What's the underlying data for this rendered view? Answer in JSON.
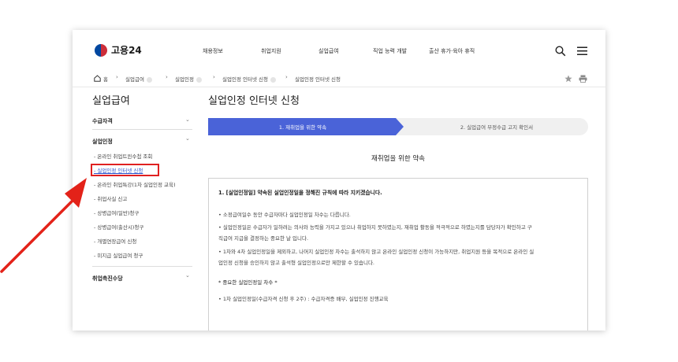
{
  "header": {
    "logo_text": "고용24",
    "nav": [
      "채용정보",
      "취업지원",
      "실업급여",
      "직업 능력 개발",
      "출산 휴가·육아 휴직"
    ]
  },
  "breadcrumb": {
    "home": "홈",
    "items": [
      "실업급여",
      "실업인정",
      "실업인정 인터넷 신청",
      "실업인정 인터넷 신청"
    ]
  },
  "sidebar": {
    "title": "실업급여",
    "sections": [
      "수급자격",
      "실업인정",
      "취업촉진수당"
    ],
    "items": [
      "- 온라인 취업트윈수첩 조회",
      "- 실업인정 인터넷 신청",
      "- 온라인 취업특강(1차 실업인정 교육)",
      "- 취업사실 신고",
      "- 상병급여(일반)청구",
      "- 상병급여(출산시)청구",
      "- 개별연장급여 신청",
      "- 미지급 실업급여 청구"
    ]
  },
  "main": {
    "title": "실업인정 인터넷 신청",
    "steps": [
      "1. 재취업을 위한 약속",
      "2. 실업급여 부정수급 고지 확인서"
    ],
    "section_title": "재취업을 위한 약속",
    "box_heading": "1. [실업인정일] 약속된 실업인정일을 정해진 규칙에 따라 지키겠습니다.",
    "bullets": [
      "• 소정급여일수 동안 수급자마다 실업인정일 차수는 다릅니다.",
      "• 실업인정일은 수급자가 일하려는 의사와 능력을 가지고 있으나 취업하지 못하였는지, 재취업 활동을 적극적으로 하였는지를 담당자가 확인하고 구",
      "  직급여 지급을 결정하는 중요한 날 입니다.",
      "• 1차와 4차 실업인정일을 제외하고, 나머지 실업인정 차수는 출석하지 않고 온라인 실업인정 신청이 가능하지만, 취업지원 등을 목적으로 온라인 실",
      "  업인정 신청을 승인하지 않고 출석형 실업인정으로만 제한할 수 있습니다.",
      "* 중요한 실업인정일 차수 *",
      "• 1차 실업인정일(수급자격 신청 후 2주) : 수급자격증 배부, 실업인정 진행교육"
    ]
  },
  "colors": {
    "step_active": "#4a63d8",
    "highlight_box": "#e02020",
    "arrow": "#e02020"
  }
}
